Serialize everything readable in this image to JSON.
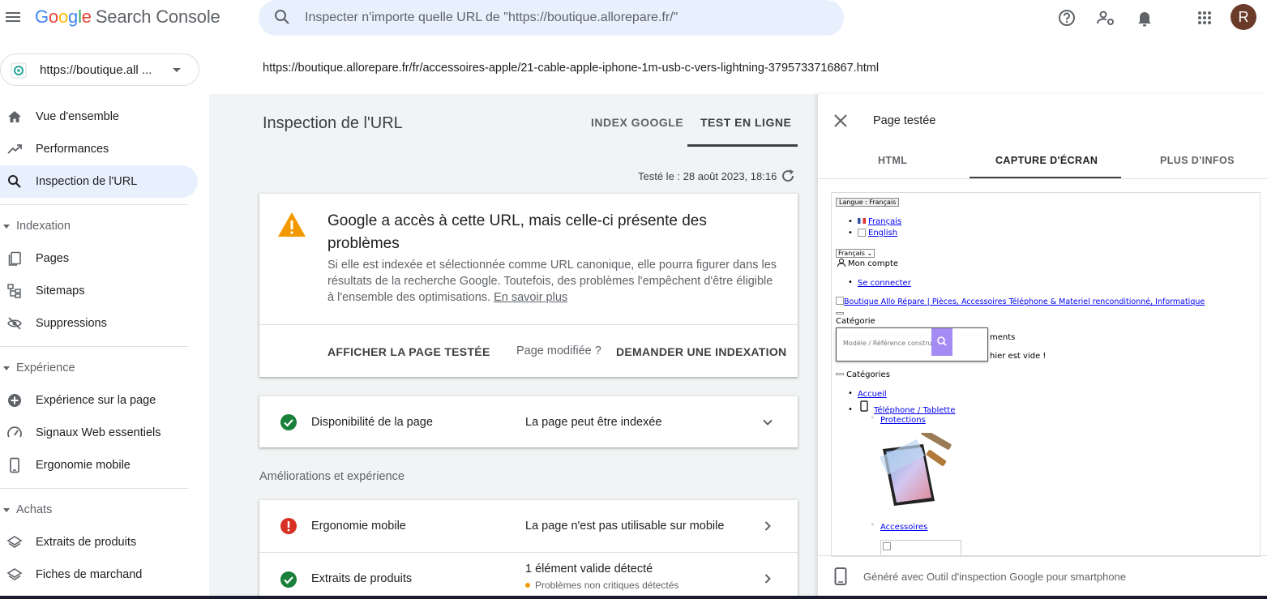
{
  "app": {
    "logo_letters": [
      "G",
      "o",
      "o",
      "g",
      "l",
      "e"
    ],
    "product": "Search Console",
    "search_placeholder": "Inspecter n'importe quelle URL de \"https://boutique.allorepare.fr/\"",
    "avatar_letter": "R"
  },
  "sidebar": {
    "property": "https://boutique.all ...",
    "items": [
      {
        "label": "Vue d'ensemble",
        "icon": "home-icon"
      },
      {
        "label": "Performances",
        "icon": "trending-up-icon"
      },
      {
        "label": "Inspection de l'URL",
        "icon": "search-icon",
        "active": true
      }
    ],
    "sections": [
      {
        "title": "Indexation",
        "items": [
          {
            "label": "Pages",
            "icon": "pages-icon"
          },
          {
            "label": "Sitemaps",
            "icon": "sitemap-icon"
          },
          {
            "label": "Suppressions",
            "icon": "eye-off-icon"
          }
        ]
      },
      {
        "title": "Expérience",
        "items": [
          {
            "label": "Expérience sur la page",
            "icon": "plus-circle-icon"
          },
          {
            "label": "Signaux Web essentiels",
            "icon": "speed-icon"
          },
          {
            "label": "Ergonomie mobile",
            "icon": "phone-icon"
          }
        ]
      },
      {
        "title": "Achats",
        "items": [
          {
            "label": "Extraits de produits",
            "icon": "layers-icon"
          },
          {
            "label": "Fiches de marchand",
            "icon": "layers-icon"
          }
        ]
      }
    ]
  },
  "main": {
    "url": "https://boutique.allorepare.fr/fr/accessoires-apple/21-cable-apple-iphone-1m-usb-c-vers-lightning-3795733716867.html",
    "title": "Inspection de l'URL",
    "tabs": [
      "INDEX GOOGLE",
      "TEST EN LIGNE"
    ],
    "tested": "Testé le : 28 août 2023, 18:16",
    "status_card": {
      "title": "Google a accès à cette URL, mais celle-ci présente des problèmes",
      "description": "Si elle est indexée et sélectionnée comme URL canonique, elle pourra figurer dans les résultats de la recherche Google. Toutefois, des problèmes l'empêchent d'être éligible à l'ensemble des optimisations.",
      "learn_more": "En savoir plus",
      "view_tested": "AFFICHER LA PAGE TESTÉE",
      "page_modified": "Page modifiée ?",
      "request_indexing": "DEMANDER UNE INDEXATION"
    },
    "availability": {
      "label": "Disponibilité de la page",
      "value": "La page peut être indexée"
    },
    "enhancements_title": "Améliorations et expérience",
    "enhancements": [
      {
        "label": "Ergonomie mobile",
        "value": "La page n'est pas utilisable sur mobile",
        "status": "error"
      },
      {
        "label": "Extraits de produits",
        "value": "1 élément valide détecté",
        "sub": "Problèmes non critiques détectés",
        "status": "ok"
      }
    ]
  },
  "panel": {
    "title": "Page testée",
    "tabs": [
      "HTML",
      "CAPTURE D'ÉCRAN",
      "PLUS D'INFOS"
    ],
    "footer": "Généré avec Outil d'inspection Google pour smartphone",
    "screenshot": {
      "lang_btn": "Langue : Français",
      "lang_fr": "Français",
      "lang_en": "English",
      "select": "Français",
      "account": "Mon compte",
      "login": "Se connecter",
      "logo_alt": "Boutique Allo Répare | Pièces, Accessoires Téléphone & Materiel renconditionné, Informatique",
      "categorie": "Catégorie",
      "search_placeholder": "Modèle / Référence constructeur",
      "frag1": "ments",
      "frag2": "hier est vide !",
      "categories": "Catégories",
      "accueil": "Accueil",
      "phone_tab": "Téléphone / Tablette",
      "protections": "Protections",
      "accessoires": "Accessoires"
    }
  },
  "colors": {
    "accent": "#1a73e8",
    "success": "#188038",
    "error": "#d93025",
    "warning": "#f29900"
  }
}
